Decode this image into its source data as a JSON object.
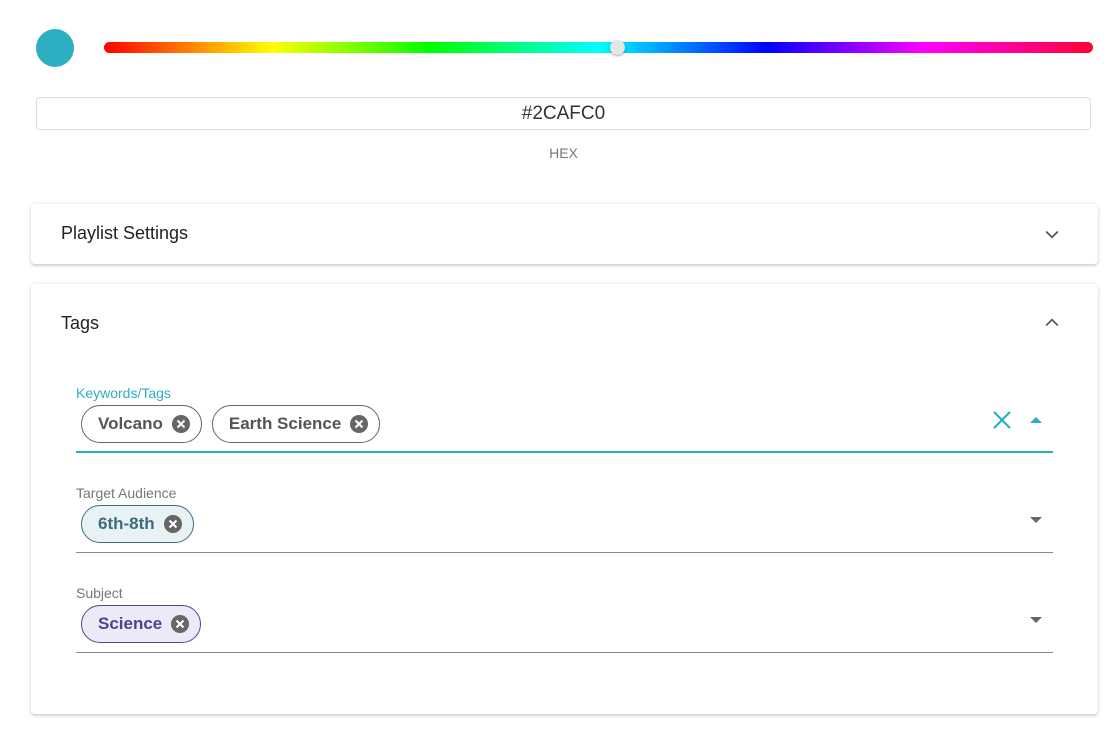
{
  "color_picker": {
    "selected_color": "#2CAFC0",
    "hue_position": 0.52,
    "hex_value": "#2CAFC0",
    "hex_label": "HEX"
  },
  "playlist_settings": {
    "title": "Playlist Settings",
    "expanded": false,
    "icon": "chevron-down-icon"
  },
  "tags": {
    "title": "Tags",
    "expanded": true,
    "icon": "chevron-up-icon",
    "keywords": {
      "label": "Keywords/Tags",
      "chips": [
        "Volcano",
        "Earth Science"
      ],
      "accent_color": "#2CAFC0"
    },
    "target_audience": {
      "label": "Target Audience",
      "chips": [
        "6th-8th"
      ]
    },
    "subject": {
      "label": "Subject",
      "chips": [
        "Science"
      ]
    }
  }
}
